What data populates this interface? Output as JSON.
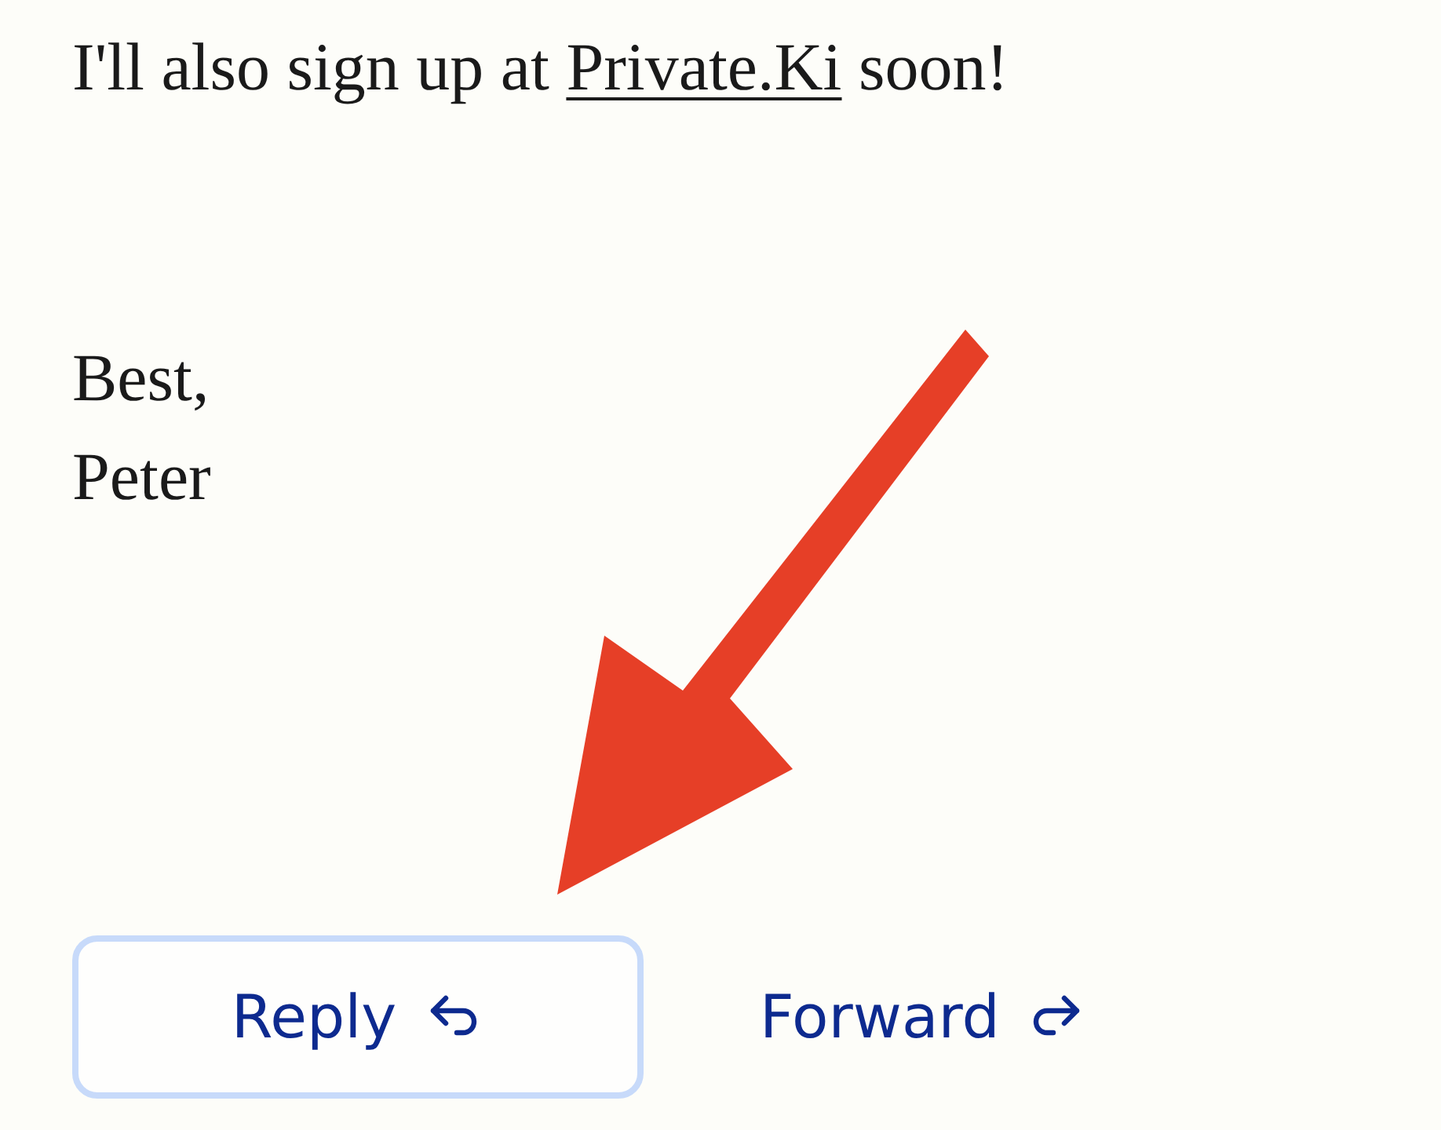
{
  "message": {
    "before": "I'll also sign up at ",
    "link": "Private.Ki",
    "after": " soon!"
  },
  "signature": [
    "Best,",
    "Peter"
  ],
  "buttons": [
    {
      "label": "Reply",
      "kind": "reply",
      "focused": true
    },
    {
      "label": "Forward",
      "kind": "forward",
      "focused": false
    }
  ]
}
